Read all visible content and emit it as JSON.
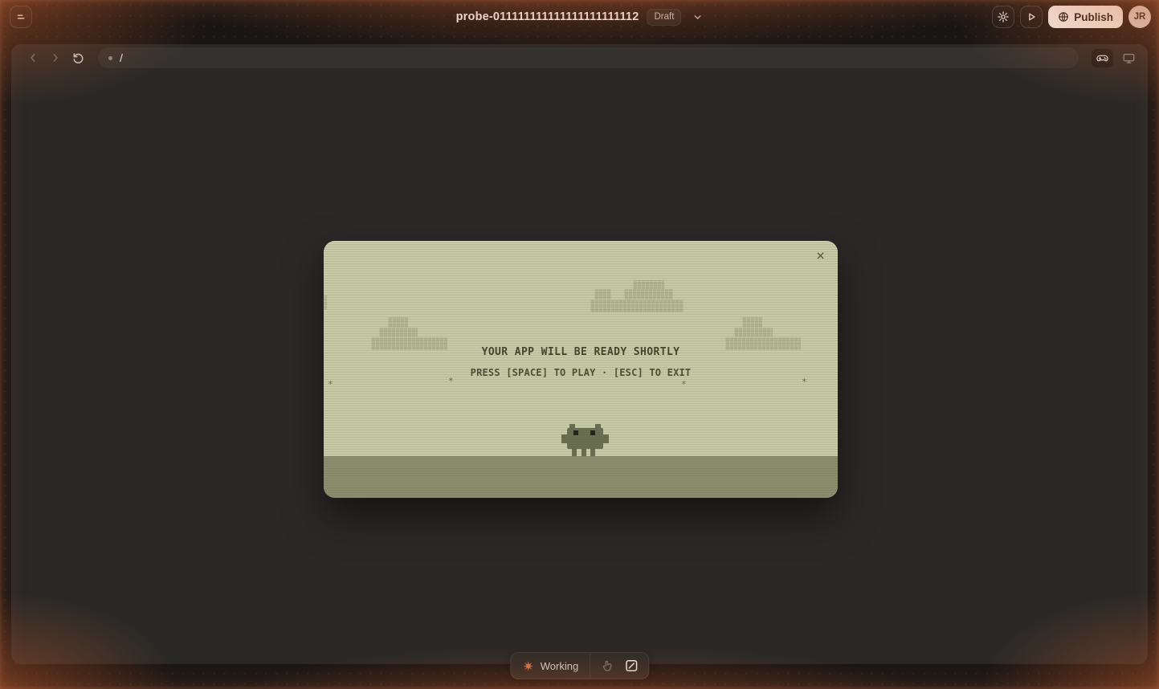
{
  "topbar": {
    "title": "probe-011111111111111111111112",
    "status": "Draft",
    "publish_label": "Publish",
    "avatar_initials": "JR"
  },
  "browser": {
    "url_path": "/"
  },
  "modal": {
    "heading": "YOUR APP WILL BE READY SHORTLY",
    "subheading": "PRESS [SPACE] TO PLAY · [ESC] TO EXIT",
    "close_glyph": "×",
    "star_glyph": "*"
  },
  "statusbar": {
    "working_label": "Working"
  },
  "icons": {
    "menu": "menu-icon",
    "chevron_down": "chevron-down-icon",
    "gear": "gear-icon",
    "play": "play-icon",
    "globe": "globe-icon",
    "back": "chevron-left-icon",
    "forward": "chevron-right-icon",
    "refresh": "refresh-icon",
    "gamepad": "gamepad-icon",
    "monitor": "monitor-icon",
    "spark": "spark-icon",
    "pointer": "pointer-hand-icon",
    "edit_square": "square-slash-icon",
    "close": "close-icon"
  },
  "colors": {
    "accent_orange": "#e27142",
    "modal_bg": "#c7caa6",
    "modal_ink": "#43472f",
    "cloud": "#b0b390",
    "ground": "#8b8e6e",
    "panel_bg": "#2a2927",
    "publish_bg": "#f4f2ef"
  }
}
